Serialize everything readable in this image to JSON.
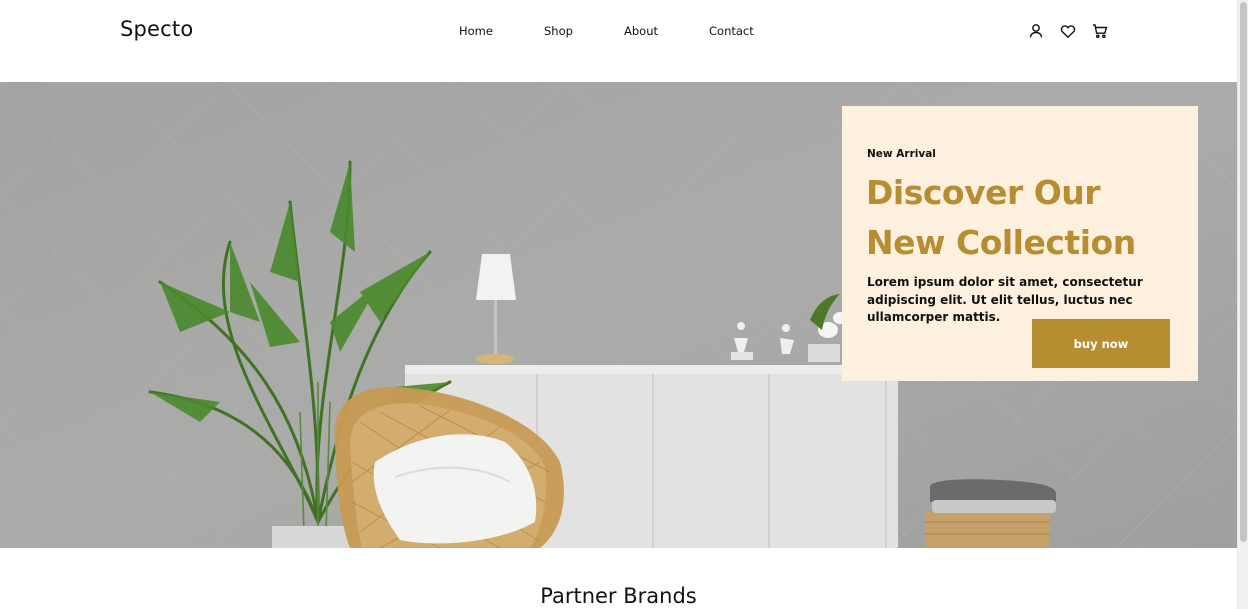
{
  "header": {
    "logo": "Specto",
    "nav": [
      "Home",
      "Shop",
      "About",
      "Contact"
    ],
    "icons": [
      "user-icon",
      "heart-icon",
      "cart-icon"
    ]
  },
  "hero": {
    "eyebrow": "New Arrival",
    "title": "Discover Our New Collection",
    "description": "Lorem ipsum dolor sit amet, consectetur adipiscing elit. Ut elit tellus, luctus nec ullamcorper mattis.",
    "button_label": "buy now"
  },
  "section": {
    "title": "Partner Brands"
  },
  "colors": {
    "accent": "#b78d32",
    "card_bg": "#fdf0df",
    "wall": "#a9a9a8"
  }
}
